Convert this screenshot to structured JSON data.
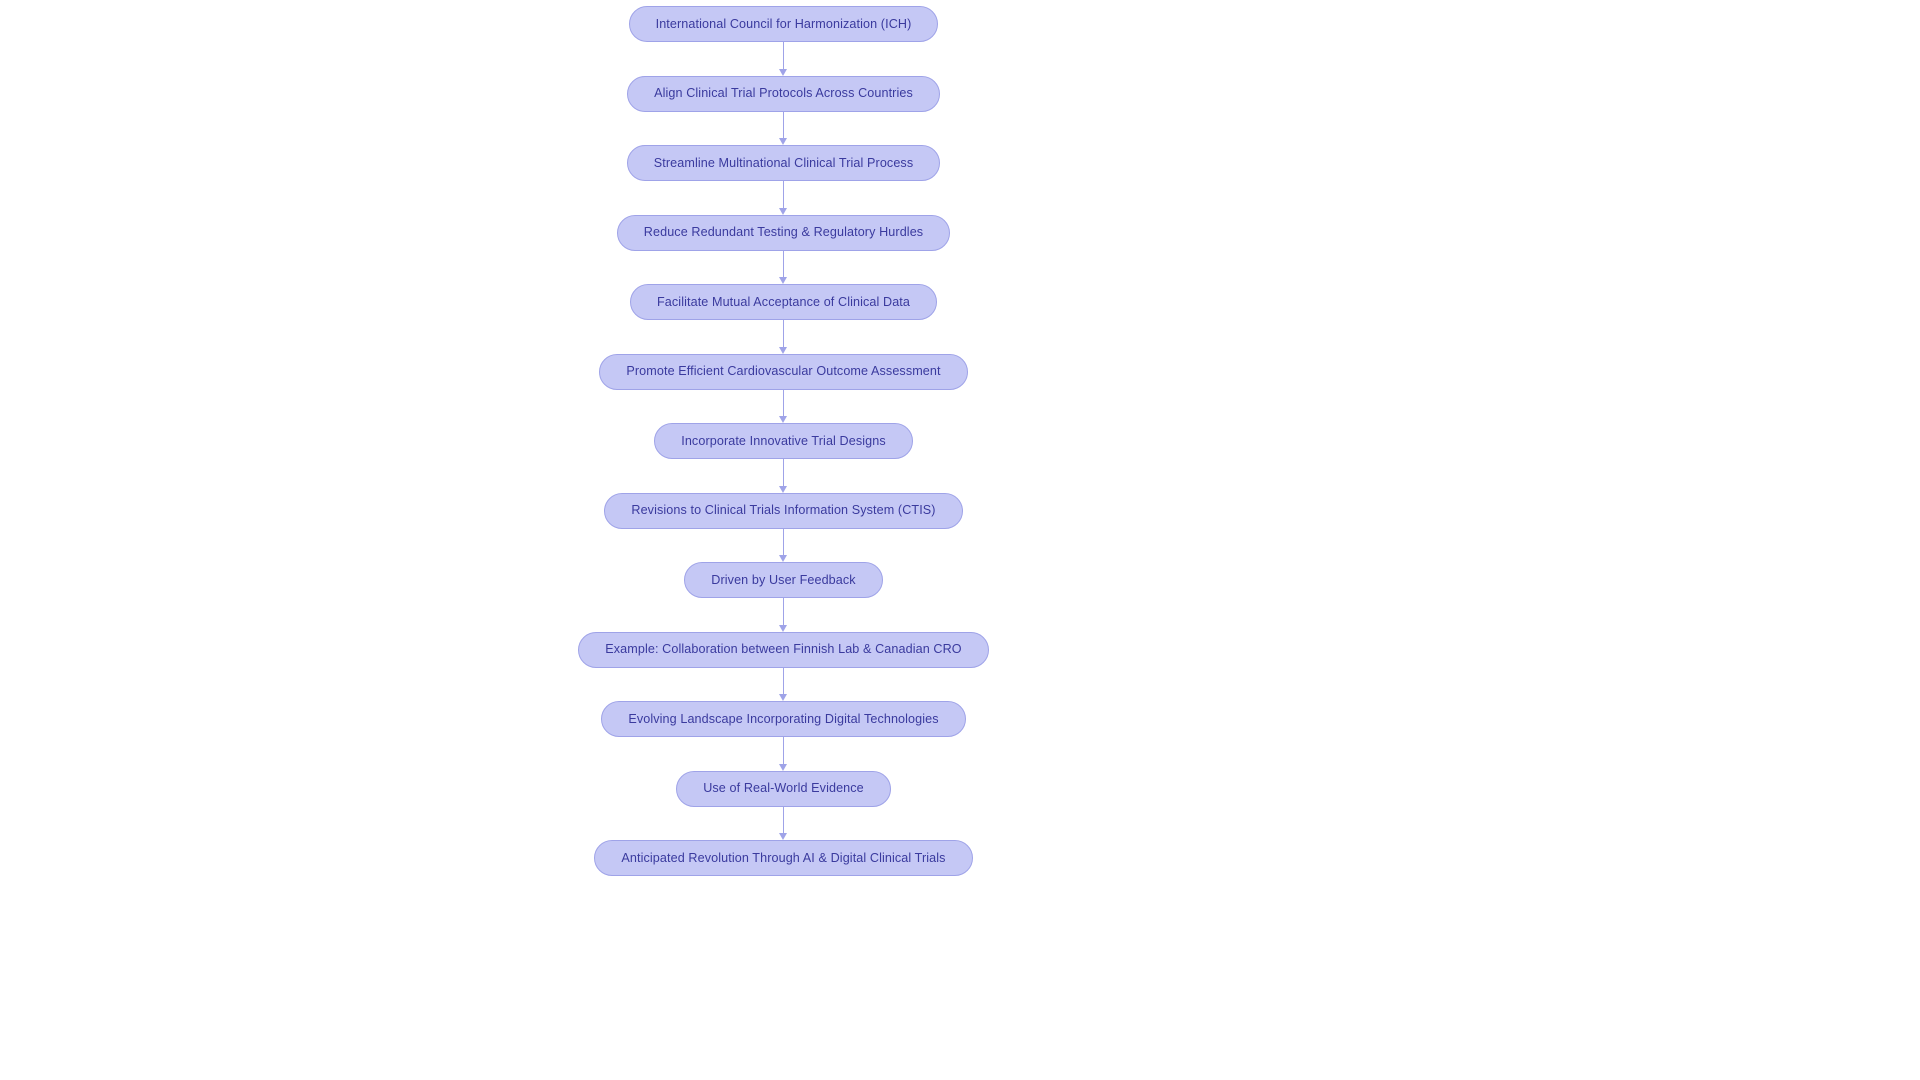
{
  "diagram": {
    "type": "flowchart",
    "orientation": "top-to-bottom",
    "background_color": "#ffffff",
    "node_fill_color": "#c5c8f5",
    "node_border_color": "#9fa3e8",
    "node_text_color": "#3a3a9e",
    "connector_color": "#9fa3e8",
    "node_shape": "pill",
    "connector_style": "straight-arrow",
    "nodes": [
      {
        "id": "n1",
        "label": "International Council for Harmonization (ICH)"
      },
      {
        "id": "n2",
        "label": "Align Clinical Trial Protocols Across Countries"
      },
      {
        "id": "n3",
        "label": "Streamline Multinational Clinical Trial Process"
      },
      {
        "id": "n4",
        "label": "Reduce Redundant Testing & Regulatory Hurdles"
      },
      {
        "id": "n5",
        "label": "Facilitate Mutual Acceptance of Clinical Data"
      },
      {
        "id": "n6",
        "label": "Promote Efficient Cardiovascular Outcome Assessment"
      },
      {
        "id": "n7",
        "label": "Incorporate Innovative Trial Designs"
      },
      {
        "id": "n8",
        "label": "Revisions to Clinical Trials Information System (CTIS)"
      },
      {
        "id": "n9",
        "label": "Driven by User Feedback"
      },
      {
        "id": "n10",
        "label": "Example: Collaboration between Finnish Lab & Canadian CRO"
      },
      {
        "id": "n11",
        "label": "Evolving Landscape Incorporating Digital Technologies"
      },
      {
        "id": "n12",
        "label": "Use of Real-World Evidence"
      },
      {
        "id": "n13",
        "label": "Anticipated Revolution Through AI & Digital Clinical Trials"
      }
    ],
    "edges": [
      {
        "from": "n1",
        "to": "n2"
      },
      {
        "from": "n2",
        "to": "n3"
      },
      {
        "from": "n3",
        "to": "n4"
      },
      {
        "from": "n4",
        "to": "n5"
      },
      {
        "from": "n5",
        "to": "n6"
      },
      {
        "from": "n6",
        "to": "n7"
      },
      {
        "from": "n7",
        "to": "n8"
      },
      {
        "from": "n8",
        "to": "n9"
      },
      {
        "from": "n9",
        "to": "n10"
      },
      {
        "from": "n10",
        "to": "n11"
      },
      {
        "from": "n11",
        "to": "n12"
      },
      {
        "from": "n12",
        "to": "n13"
      }
    ]
  }
}
